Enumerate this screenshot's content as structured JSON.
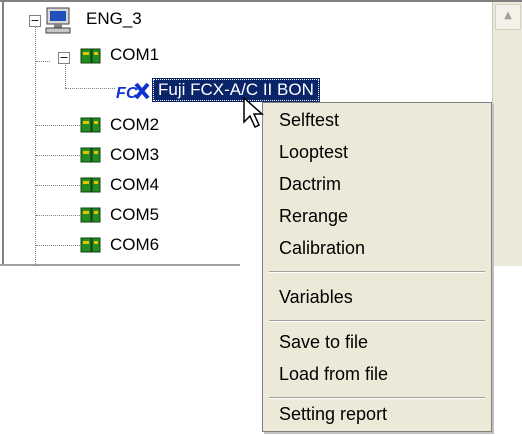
{
  "tree": {
    "root": {
      "label": "ENG_3"
    },
    "ports": [
      {
        "label": "COM1"
      },
      {
        "label": "COM2"
      },
      {
        "label": "COM3"
      },
      {
        "label": "COM4"
      },
      {
        "label": "COM5"
      },
      {
        "label": "COM6"
      }
    ],
    "device": {
      "label": "Fuji FCX-A/C II BON"
    }
  },
  "context_menu": {
    "items": [
      {
        "label": "Selftest"
      },
      {
        "label": "Looptest"
      },
      {
        "label": "Dactrim"
      },
      {
        "label": "Rerange"
      },
      {
        "label": "Calibration"
      },
      {
        "label": "Variables"
      },
      {
        "label": "Save to file"
      },
      {
        "label": "Load from file"
      },
      {
        "label": "Setting report"
      }
    ]
  },
  "colors": {
    "selection": "#0a246a",
    "menu_background": "#ece9d8",
    "port_icon": "#228b22"
  },
  "icons": {
    "root": "computer-icon",
    "port": "serial-port-icon",
    "device": "fuji-device-icon",
    "expander": "expander-icon",
    "cursor": "mouse-cursor-icon"
  }
}
